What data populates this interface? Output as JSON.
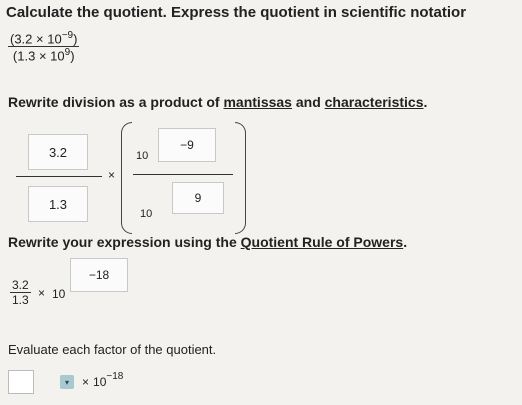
{
  "problem": {
    "instruction": "Calculate the quotient. Express the quotient in scientific notatior",
    "numerator": {
      "mantissa": "(3.2",
      "times": "×",
      "base": "10",
      "exponent": "−9",
      "close": ")"
    },
    "denominator": {
      "mantissa": "(1.3",
      "times": "×",
      "base": "10",
      "exponent": "9",
      "close": ")"
    }
  },
  "step1": {
    "text_pre": "Rewrite division as a product of ",
    "link1": "mantissas",
    "text_mid": " and ",
    "link2": "characteristics",
    "text_post": ".",
    "frac_num": "3.2",
    "frac_den": "1.3",
    "times": "×",
    "inner_num_base": "10",
    "inner_num_exp": "−9",
    "inner_den_base": "10",
    "inner_den_exp": "9"
  },
  "step2": {
    "text_pre": "Rewrite your expression using the ",
    "link": "Quotient Rule of Powers",
    "text_post": ".",
    "frac_num": "3.2",
    "frac_den": "1.3",
    "times": "×",
    "base": "10",
    "exponent": "−18"
  },
  "step3": {
    "text": "Evaluate each factor of the quotient.",
    "answer_value": "",
    "times": "×",
    "base": "10",
    "exponent": "−18",
    "dropdown_glyph": "▾"
  }
}
